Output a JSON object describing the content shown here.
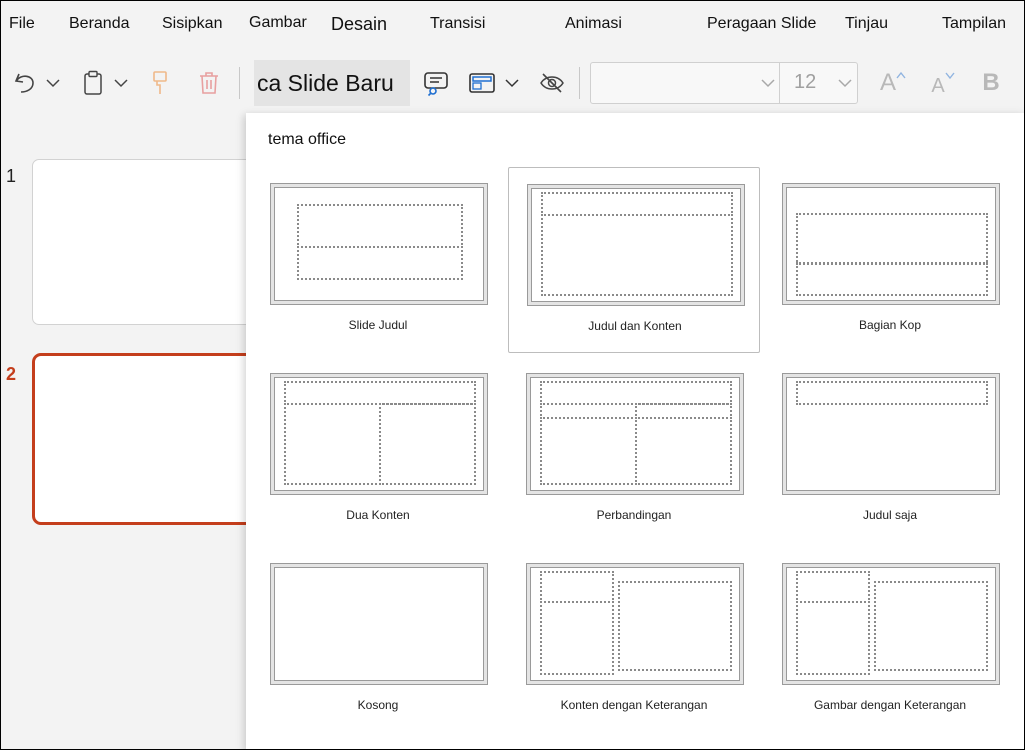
{
  "menu": {
    "items": [
      "File",
      "Beranda",
      "Sisipkan",
      "Gambar",
      "Desain",
      "Transisi",
      "Animasi",
      "Peragaan Slide",
      "Tinjau",
      "Tampilan"
    ]
  },
  "toolbar": {
    "undo_icon": "undo-icon",
    "paste_icon": "clipboard-icon",
    "format_painter_icon": "format-painter-icon",
    "delete_icon": "trash-icon",
    "new_slide_label": "ca Slide Baru",
    "font_name": "",
    "font_size": "12",
    "grow_font_label": "A",
    "shrink_font_label": "A",
    "bold_label": "B",
    "accent_color": "#c43e1c"
  },
  "slides": [
    {
      "number": "1",
      "selected": false
    },
    {
      "number": "2",
      "selected": true
    }
  ],
  "layout_gallery": {
    "title": "tema office",
    "selected": "Judul dan Konten",
    "layouts": [
      "Slide Judul",
      "Judul dan Konten",
      "Bagian   Kop",
      "Dua Konten",
      "Perbandingan",
      "Judul saja",
      "Kosong",
      "Konten dengan Keterangan",
      "Gambar dengan Keterangan"
    ]
  }
}
